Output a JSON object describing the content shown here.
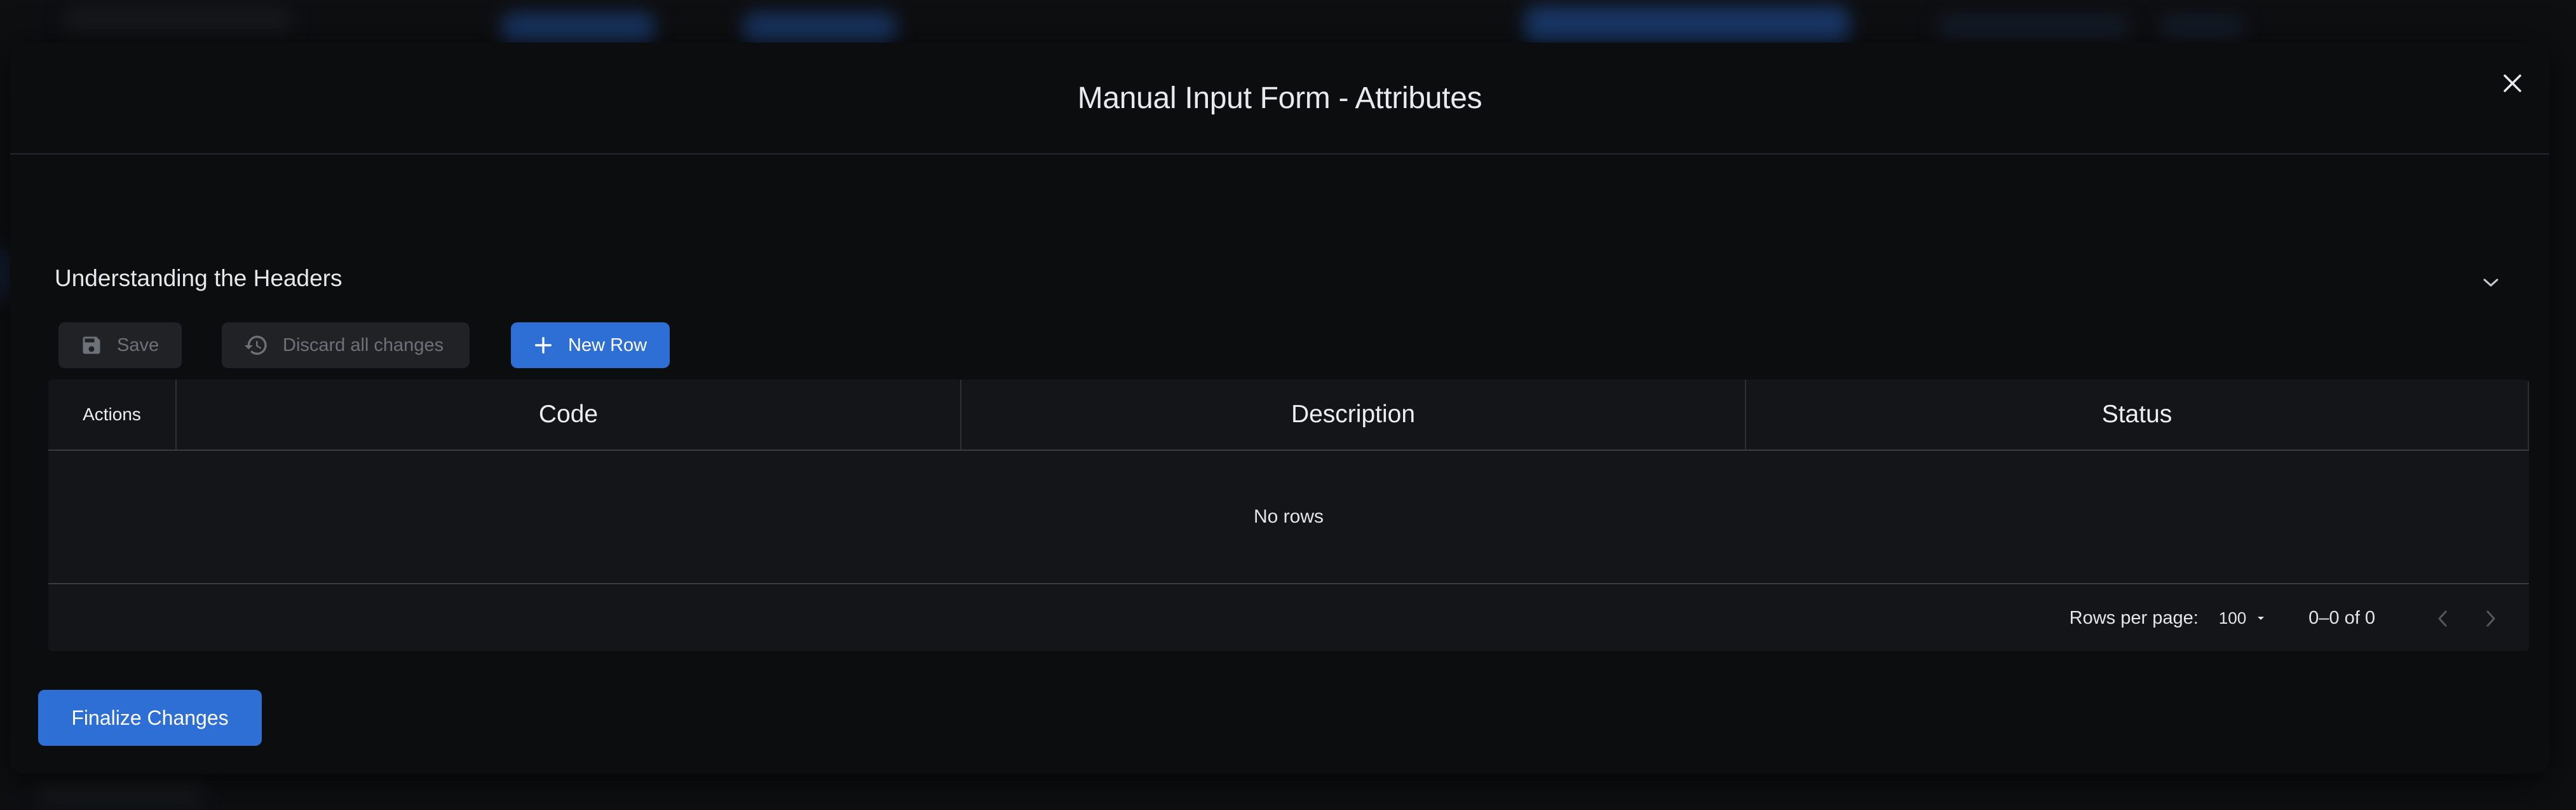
{
  "modal": {
    "title": "Manual Input Form - Attributes"
  },
  "section": {
    "title": "Understanding the Headers"
  },
  "toolbar": {
    "save_label": "Save",
    "discard_label": "Discard all changes",
    "new_row_label": "New Row"
  },
  "grid": {
    "columns": [
      "Actions",
      "Code",
      "Description",
      "Status"
    ],
    "empty_text": "No rows"
  },
  "pagination": {
    "rows_per_page_label": "Rows per page:",
    "rows_per_page_value": "100",
    "range_text": "0–0 of 0"
  },
  "footer": {
    "finalize_label": "Finalize Changes"
  },
  "colors": {
    "accent": "#2d6fd4",
    "modal_bg": "#0c0d0f",
    "grid_bg": "#141518"
  }
}
